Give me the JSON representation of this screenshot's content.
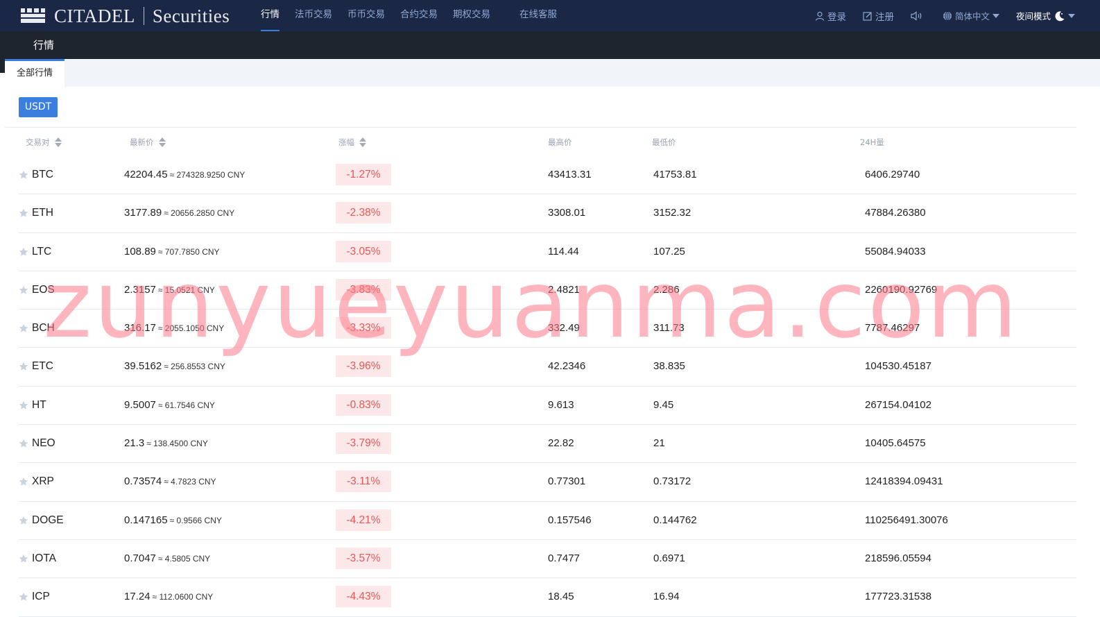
{
  "header": {
    "brand": "CITADEL",
    "brand_sub": "Securities",
    "nav": [
      {
        "label": "行情",
        "active": true
      },
      {
        "label": "法币交易",
        "active": false
      },
      {
        "label": "币币交易",
        "active": false
      },
      {
        "label": "合约交易",
        "active": false
      },
      {
        "label": "期权交易",
        "active": false
      },
      {
        "label": "在线客服",
        "active": false
      }
    ],
    "right": {
      "login": "登录",
      "register": "注册",
      "language": "简体中文",
      "night_mode": "夜间模式"
    }
  },
  "subbar": {
    "title": "行情"
  },
  "tabs": [
    {
      "label": "全部行情",
      "active": true
    }
  ],
  "filter": {
    "quote_button": "USDT"
  },
  "table": {
    "columns": [
      "交易对",
      "最新价",
      "涨幅",
      "最高价",
      "最低价",
      "24H量"
    ],
    "rows": [
      {
        "symbol": "BTC",
        "price": "42204.45",
        "cny": "≈ 274328.9250 CNY",
        "change": "-1.27%",
        "high": "43413.31",
        "low": "41753.81",
        "volume": "6406.29740"
      },
      {
        "symbol": "ETH",
        "price": "3177.89",
        "cny": "≈ 20656.2850 CNY",
        "change": "-2.38%",
        "high": "3308.01",
        "low": "3152.32",
        "volume": "47884.26380"
      },
      {
        "symbol": "LTC",
        "price": "108.89",
        "cny": "≈ 707.7850 CNY",
        "change": "-3.05%",
        "high": "114.44",
        "low": "107.25",
        "volume": "55084.94033"
      },
      {
        "symbol": "EOS",
        "price": "2.3157",
        "cny": "≈ 15.0521 CNY",
        "change": "-3.83%",
        "high": "2.4821",
        "low": "2.286",
        "volume": "2260190.92769"
      },
      {
        "symbol": "BCH",
        "price": "316.17",
        "cny": "≈ 2055.1050 CNY",
        "change": "-3.33%",
        "high": "332.49",
        "low": "311.73",
        "volume": "7787.46297"
      },
      {
        "symbol": "ETC",
        "price": "39.5162",
        "cny": "≈ 256.8553 CNY",
        "change": "-3.96%",
        "high": "42.2346",
        "low": "38.835",
        "volume": "104530.45187"
      },
      {
        "symbol": "HT",
        "price": "9.5007",
        "cny": "≈ 61.7546 CNY",
        "change": "-0.83%",
        "high": "9.613",
        "low": "9.45",
        "volume": "267154.04102"
      },
      {
        "symbol": "NEO",
        "price": "21.3",
        "cny": "≈ 138.4500 CNY",
        "change": "-3.79%",
        "high": "22.82",
        "low": "21",
        "volume": "10405.64575"
      },
      {
        "symbol": "XRP",
        "price": "0.73574",
        "cny": "≈ 4.7823 CNY",
        "change": "-3.11%",
        "high": "0.77301",
        "low": "0.73172",
        "volume": "12418394.09431"
      },
      {
        "symbol": "DOGE",
        "price": "0.147165",
        "cny": "≈ 0.9566 CNY",
        "change": "-4.21%",
        "high": "0.157546",
        "low": "0.144762",
        "volume": "110256491.30076"
      },
      {
        "symbol": "IOTA",
        "price": "0.7047",
        "cny": "≈ 4.5805 CNY",
        "change": "-3.57%",
        "high": "0.7477",
        "low": "0.6971",
        "volume": "218596.05594"
      },
      {
        "symbol": "ICP",
        "price": "17.24",
        "cny": "≈ 112.0600 CNY",
        "change": "-4.43%",
        "high": "18.45",
        "low": "16.94",
        "volume": "177723.31538"
      }
    ]
  },
  "watermark": "zunyueyuanma.com",
  "colors": {
    "accent": "#3a7ee0",
    "down": "#ef5555",
    "down_bg": "#fce8e8",
    "topbar": "#1b2845",
    "subbar": "#1f252e"
  }
}
